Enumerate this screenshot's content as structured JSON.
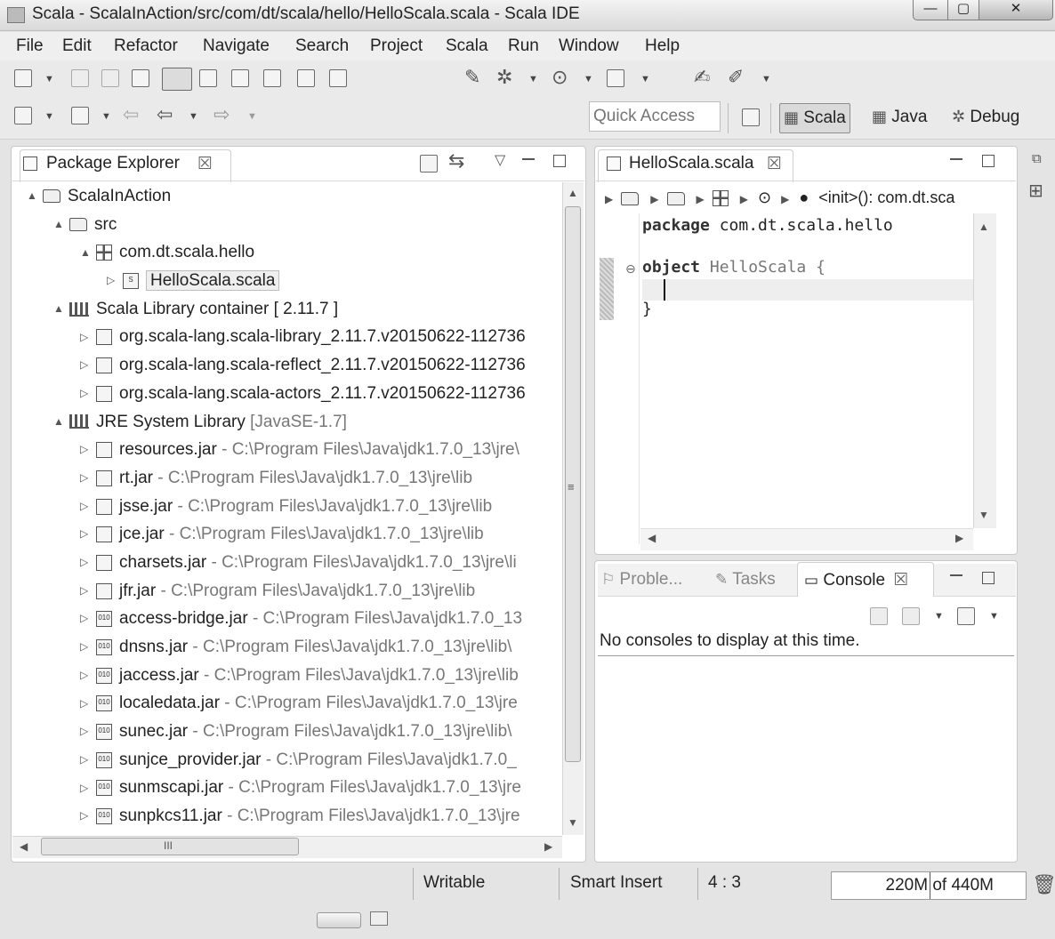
{
  "window": {
    "title": "Scala - ScalaInAction/src/com/dt/scala/hello/HelloScala.scala - Scala IDE",
    "min_glyph": "—",
    "max_glyph": "▢",
    "close_glyph": "✕"
  },
  "menu": [
    "File",
    "Edit",
    "Refactor",
    "Navigate",
    "Search",
    "Project",
    "Scala",
    "Run",
    "Window",
    "Help"
  ],
  "toolbar": {
    "quick_access_placeholder": "Quick Access",
    "perspectives": [
      {
        "label": "Scala",
        "active": true
      },
      {
        "label": "Java",
        "active": false
      },
      {
        "label": "Debug",
        "active": false
      }
    ]
  },
  "package_explorer": {
    "tab_label": "Package Explorer",
    "close_glyph": "☒",
    "tree": [
      {
        "indent": 0,
        "expand": "▲",
        "icon": "project",
        "label": "ScalaInAction",
        "detail": ""
      },
      {
        "indent": 1,
        "expand": "▲",
        "icon": "src",
        "label": "src",
        "detail": ""
      },
      {
        "indent": 2,
        "expand": "▲",
        "icon": "package",
        "label": "com.dt.scala.hello",
        "detail": ""
      },
      {
        "indent": 3,
        "expand": "▷",
        "icon": "file",
        "label": "HelloScala.scala",
        "detail": "",
        "selected": true
      },
      {
        "indent": 1,
        "expand": "▲",
        "icon": "library",
        "label": "Scala Library container [ 2.11.7 ]",
        "detail": ""
      },
      {
        "indent": 2,
        "expand": "▷",
        "icon": "jar",
        "label": "org.scala-lang.scala-library_2.11.7.v20150622-112736",
        "detail": ""
      },
      {
        "indent": 2,
        "expand": "▷",
        "icon": "jar",
        "label": "org.scala-lang.scala-reflect_2.11.7.v20150622-112736",
        "detail": ""
      },
      {
        "indent": 2,
        "expand": "▷",
        "icon": "jar",
        "label": "org.scala-lang.scala-actors_2.11.7.v20150622-112736",
        "detail": ""
      },
      {
        "indent": 1,
        "expand": "▲",
        "icon": "library",
        "label": "JRE System Library",
        "detail": " [JavaSE-1.7]"
      },
      {
        "indent": 2,
        "expand": "▷",
        "icon": "jar",
        "label": "resources.jar",
        "detail": " - C:\\Program Files\\Java\\jdk1.7.0_13\\jre\\"
      },
      {
        "indent": 2,
        "expand": "▷",
        "icon": "jar",
        "label": "rt.jar",
        "detail": " - C:\\Program Files\\Java\\jdk1.7.0_13\\jre\\lib"
      },
      {
        "indent": 2,
        "expand": "▷",
        "icon": "jar",
        "label": "jsse.jar",
        "detail": " - C:\\Program Files\\Java\\jdk1.7.0_13\\jre\\lib"
      },
      {
        "indent": 2,
        "expand": "▷",
        "icon": "jar",
        "label": "jce.jar",
        "detail": " - C:\\Program Files\\Java\\jdk1.7.0_13\\jre\\lib"
      },
      {
        "indent": 2,
        "expand": "▷",
        "icon": "jar",
        "label": "charsets.jar",
        "detail": " - C:\\Program Files\\Java\\jdk1.7.0_13\\jre\\li"
      },
      {
        "indent": 2,
        "expand": "▷",
        "icon": "jar",
        "label": "jfr.jar",
        "detail": " - C:\\Program Files\\Java\\jdk1.7.0_13\\jre\\lib"
      },
      {
        "indent": 2,
        "expand": "▷",
        "icon": "jar010",
        "label": "access-bridge.jar",
        "detail": " - C:\\Program Files\\Java\\jdk1.7.0_13"
      },
      {
        "indent": 2,
        "expand": "▷",
        "icon": "jar010",
        "label": "dnsns.jar",
        "detail": " - C:\\Program Files\\Java\\jdk1.7.0_13\\jre\\lib\\"
      },
      {
        "indent": 2,
        "expand": "▷",
        "icon": "jar010",
        "label": "jaccess.jar",
        "detail": " - C:\\Program Files\\Java\\jdk1.7.0_13\\jre\\lib"
      },
      {
        "indent": 2,
        "expand": "▷",
        "icon": "jar010",
        "label": "localedata.jar",
        "detail": " - C:\\Program Files\\Java\\jdk1.7.0_13\\jre"
      },
      {
        "indent": 2,
        "expand": "▷",
        "icon": "jar010",
        "label": "sunec.jar",
        "detail": " - C:\\Program Files\\Java\\jdk1.7.0_13\\jre\\lib\\"
      },
      {
        "indent": 2,
        "expand": "▷",
        "icon": "jar010",
        "label": "sunjce_provider.jar",
        "detail": " - C:\\Program Files\\Java\\jdk1.7.0_"
      },
      {
        "indent": 2,
        "expand": "▷",
        "icon": "jar010",
        "label": "sunmscapi.jar",
        "detail": " - C:\\Program Files\\Java\\jdk1.7.0_13\\jre"
      },
      {
        "indent": 2,
        "expand": "▷",
        "icon": "jar010",
        "label": "sunpkcs11.jar",
        "detail": " - C:\\Program Files\\Java\\jdk1.7.0_13\\jre"
      }
    ],
    "hscroll_grip": "III"
  },
  "editor": {
    "tab_label": "HelloScala.scala",
    "close_glyph": "☒",
    "breadcrumb_tail": "<init>(): com.dt.sca",
    "code_lines": [
      {
        "kw": "package",
        "rest": " com.dt.scala.hello"
      },
      {
        "kw": "",
        "rest": ""
      },
      {
        "kw": "object",
        "rest": " HelloScala {",
        "ident": "HelloScala"
      },
      {
        "kw": "",
        "rest": ""
      },
      {
        "kw": "",
        "rest": "}"
      }
    ]
  },
  "console_panel": {
    "tabs": [
      {
        "label": "Proble...",
        "active": false
      },
      {
        "label": "Tasks",
        "active": false
      },
      {
        "label": "Console",
        "active": true
      }
    ],
    "close_glyph": "☒",
    "message": "No consoles to display at this time."
  },
  "status": {
    "writable": "Writable",
    "insert_mode": "Smart Insert",
    "cursor_pos": "4 : 3",
    "heap": "220M of 440M"
  }
}
